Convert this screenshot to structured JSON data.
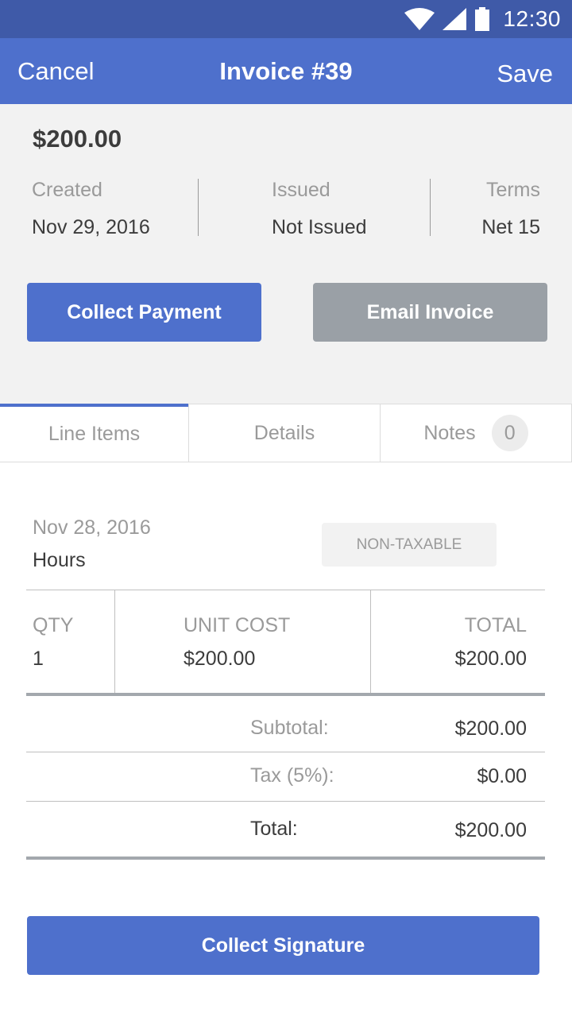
{
  "status_bar": {
    "time": "12:30",
    "icons": [
      "wifi-icon",
      "cell-signal-icon",
      "battery-icon"
    ]
  },
  "app_bar": {
    "cancel_label": "Cancel",
    "title": "Invoice #39",
    "save_label": "Save"
  },
  "summary": {
    "amount": "$200.00",
    "created_label": "Created",
    "created_value": "Nov 29, 2016",
    "issued_label": "Issued",
    "issued_value": "Not Issued",
    "terms_label": "Terms",
    "terms_value": "Net 15",
    "collect_payment_label": "Collect Payment",
    "email_invoice_label": "Email Invoice"
  },
  "tabs": {
    "line_items": "Line Items",
    "details": "Details",
    "notes": "Notes",
    "notes_count": "0",
    "active": "line_items"
  },
  "line_item": {
    "date": "Nov 28, 2016",
    "name": "Hours",
    "tax_badge": "NON-TAXABLE",
    "qty_label": "QTY",
    "qty_value": "1",
    "unit_cost_label": "UNIT COST",
    "unit_cost_value": "$200.00",
    "total_label": "TOTAL",
    "total_value": "$200.00"
  },
  "totals": {
    "subtotal_label": "Subtotal:",
    "subtotal_value": "$200.00",
    "tax_label": "Tax (5%):",
    "tax_value": "$0.00",
    "total_label": "Total:",
    "total_value": "$200.00"
  },
  "collect_signature_label": "Collect Signature",
  "colors": {
    "status_bar": "#3f5aa8",
    "app_bar": "#4e70cc",
    "primary_button": "#4e70cc",
    "secondary_button": "#9aa0a6",
    "summary_background": "#f2f2f2"
  }
}
